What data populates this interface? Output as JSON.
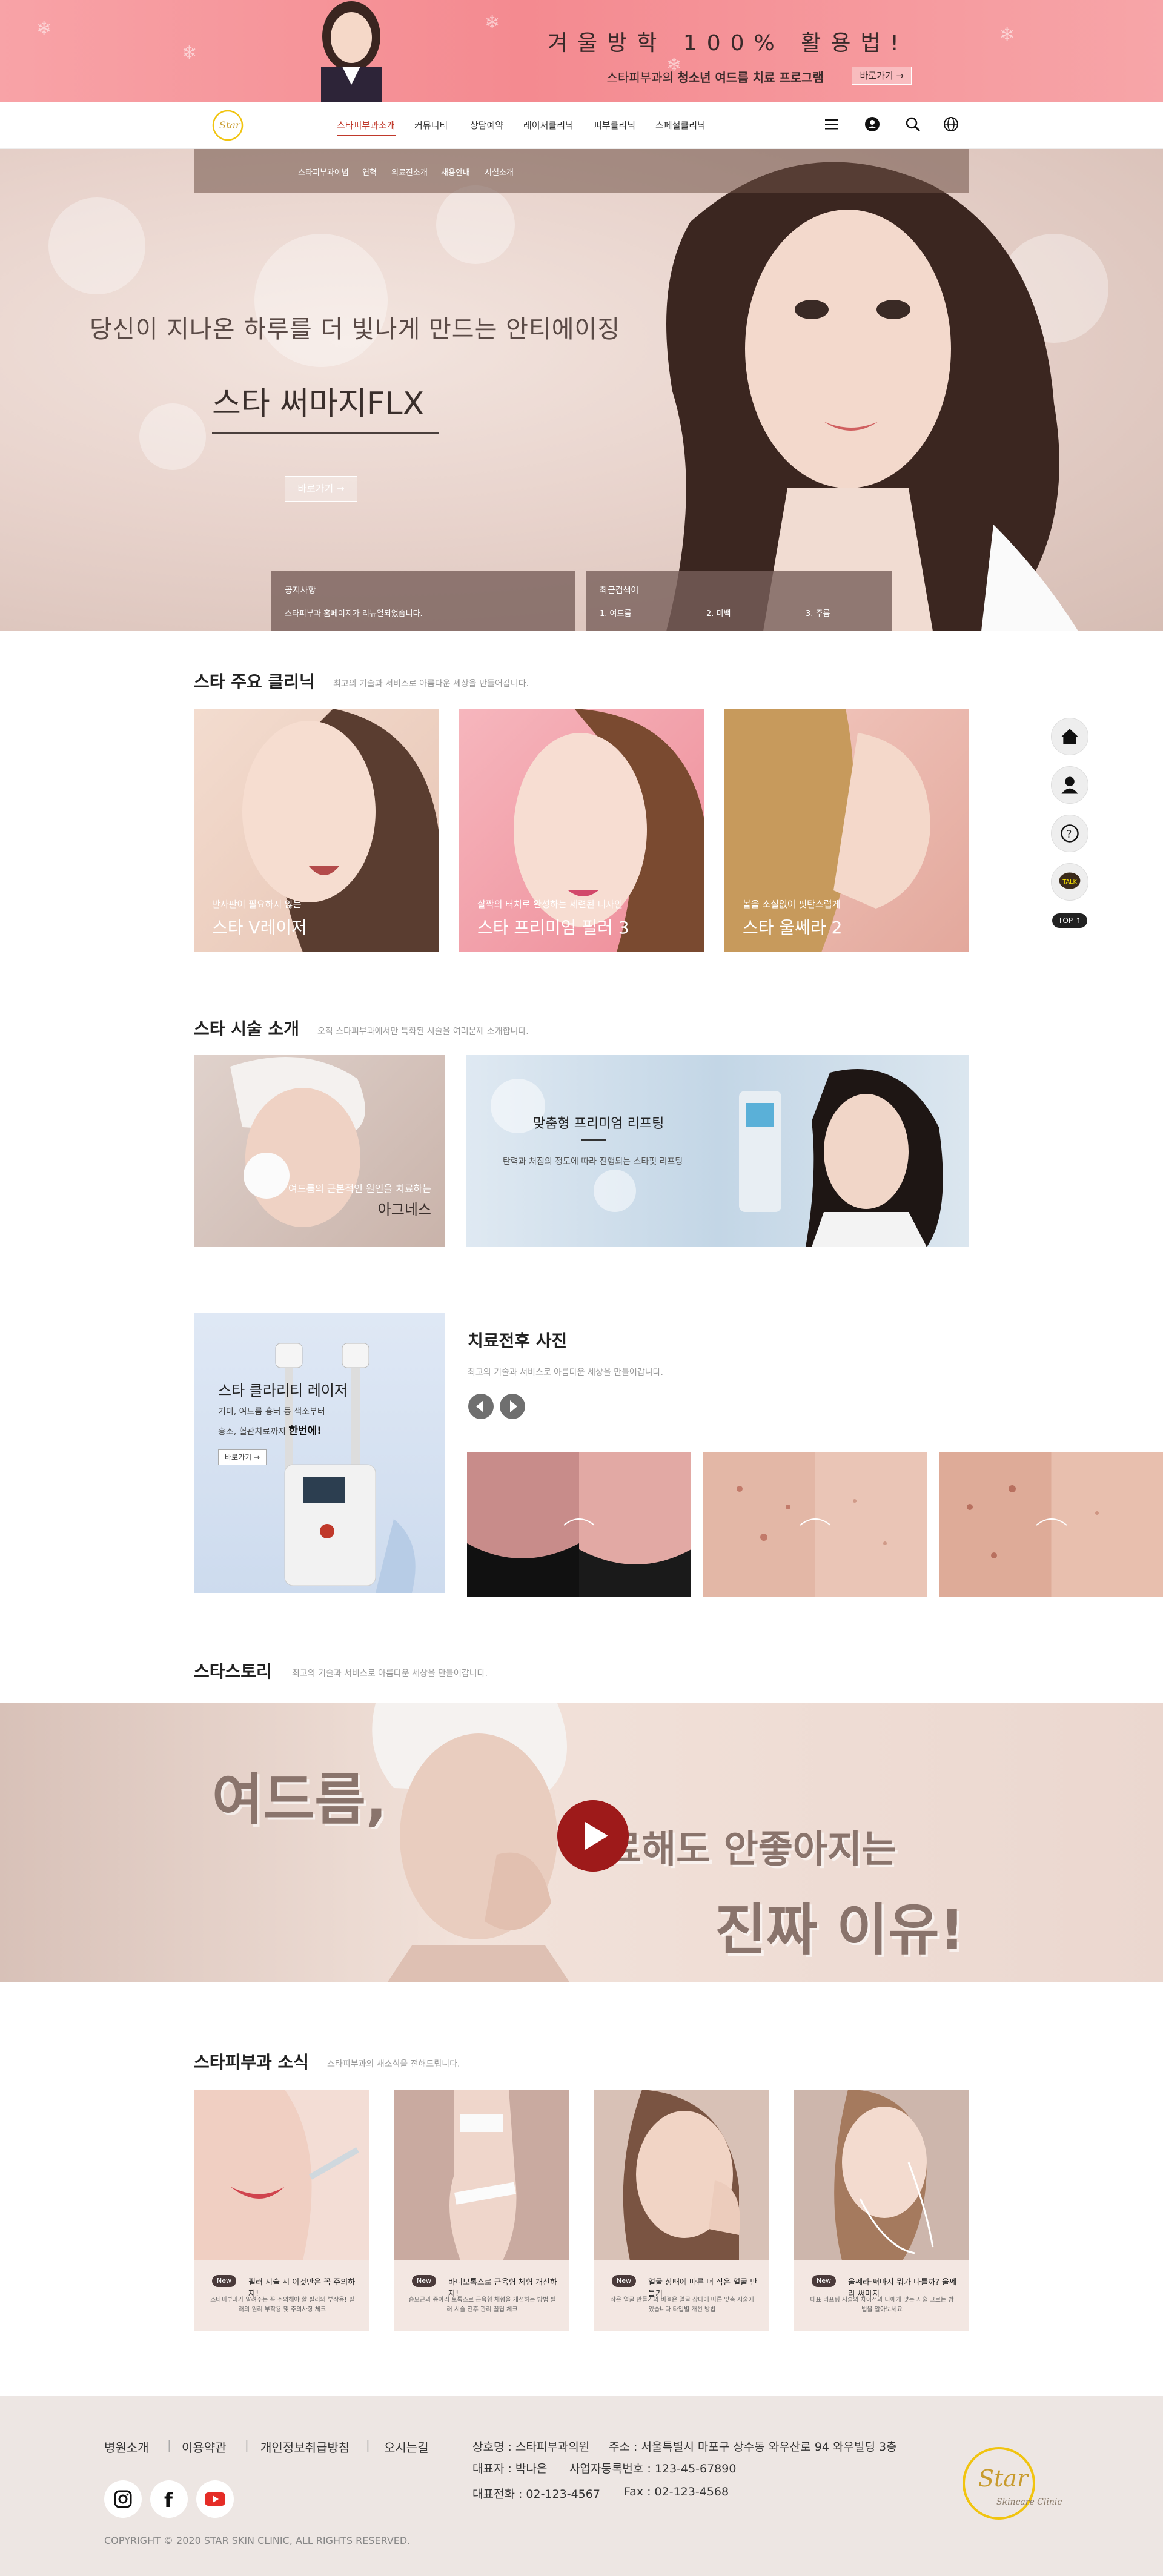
{
  "promo": {
    "headline": "겨울방학 100% 활용법!",
    "sub_prefix": "스타피부과의 ",
    "sub_bold": "청소년 여드름 치료 프로그램",
    "button": "바로가기 →"
  },
  "nav": {
    "items": [
      "스타피부과소개",
      "커뮤니티",
      "상담예약",
      "레이저클리닉",
      "피부클리닉",
      "스페셜클리닉"
    ],
    "active_index": 0
  },
  "subnav": {
    "items": [
      "스타피부과이념",
      "연혁",
      "의료진소개",
      "채용안내",
      "시설소개"
    ]
  },
  "hero": {
    "tagline": "당신이 지나온 하루를 더 빛나게 만드는 안티에이징",
    "title": "스타 써마지FLX",
    "button": "바로가기 →"
  },
  "notice": {
    "title": "공지사항",
    "text": "스타피부과 홈페이지가 리뉴얼되었습니다."
  },
  "recent_search": {
    "title": "최근검색어",
    "items": [
      "1. 여드름",
      "2. 미백",
      "3. 주름"
    ]
  },
  "clinic": {
    "title": "스타 주요 클리닉",
    "desc": "최고의 기술과 서비스로 아름다운 세상을 만들어갑니다.",
    "cards": [
      {
        "caption": "반사판이 필요하지 않는",
        "name": "스타 V레이저"
      },
      {
        "caption": "살짝의 터치로 완성하는 세련된 디자인",
        "name": "스타 프리미엄 필러 3"
      },
      {
        "caption": "볼을 소실없이 핏탄스럽게",
        "name": "스타 울쎄라 2"
      }
    ]
  },
  "treatment": {
    "title": "스타 시술 소개",
    "desc": "오직 스타피부과에서만 특화된 시술을 여러분께 소개합니다.",
    "left_caption": "여드름의 근본적인 원인을 치료하는",
    "left_name": "아그네스",
    "right_title": "맞춤형 프리미엄 리프팅",
    "right_desc": "탄력과 처짐의 정도에 따라 진행되는 스타핏 리프팅"
  },
  "laser": {
    "title": "스타 클라리티 레이저",
    "desc_line1": "기미, 여드름 흉터 등 색소부터",
    "desc_line2_prefix": "홍조, 혈관치료까지 ",
    "desc_line2_bold": "한번에!",
    "button": "바로가기 →"
  },
  "photos": {
    "title": "치료전후 사진",
    "desc": "최고의 기술과 서비스로 아름다운 세상을 만들어갑니다."
  },
  "story": {
    "title": "스타스토리",
    "desc": "최고의 기술과 서비스로 아름다운 세상을 만들어갑니다.",
    "line1": "여드름,",
    "line2": "치료해도 안좋아지는",
    "line3": "진짜 이유!"
  },
  "news": {
    "title": "스타피부과 소식",
    "desc": "스타피부과의 새소식을 전해드립니다.",
    "badge": "New",
    "cards": [
      {
        "title": "필러 시술 시 이것만은 꼭 주의하자!",
        "desc": "스타피부과가 알려주는 꼭 주의해야 할 필러의 부작용! 필러의 원리 부작용 및 주의사항 체크"
      },
      {
        "title": "바디보톡스로 근육형 체형 개선하자!",
        "desc": "승모근과 종아리 보톡스로 근육형 체형을 개선하는 방법 필러 시술 전후 관리 꿀팁 체크"
      },
      {
        "title": "얼굴 상태에 따른 더 작은 얼굴 만들기",
        "desc": "작은 얼굴 만들기의 비결은 얼굴 상태에 따른 맞춤 시술에 있습니다 타입별 개선 방법"
      },
      {
        "title": "울쎄라·써마지 뭐가 다를까? 울쎄라 써마지",
        "desc": "대표 리프팅 시술의 차이점과 나에게 맞는 시술 고르는 방법을 알아보세요"
      }
    ]
  },
  "side_quick": {
    "top_label": "TOP ↑",
    "talk_label": "TALK"
  },
  "footer": {
    "links": [
      "병원소개",
      "이용약관",
      "개인정보취급방침",
      "오시는길"
    ],
    "company": "상호명 : 스타피부과의원",
    "address": "주소 : 서울특별시 마포구 상수동 와우산로 94 와우빌딩 3층",
    "ceo": "대표자 : 박나은",
    "biz_no": "사업자등록번호 : 123-45-67890",
    "tel": "대표전화 : 02-123-4567",
    "fax": "Fax : 02-123-4568",
    "copyright": "COPYRIGHT © 2020 STAR SKIN CLINIC, ALL RIGHTS RESERVED."
  },
  "colors": {
    "accent": "#c0392b",
    "promo_bg": "#f48a90",
    "brown_box": "#785f5a",
    "play": "#9e1a1a",
    "footer_bg": "#ede6e3"
  }
}
